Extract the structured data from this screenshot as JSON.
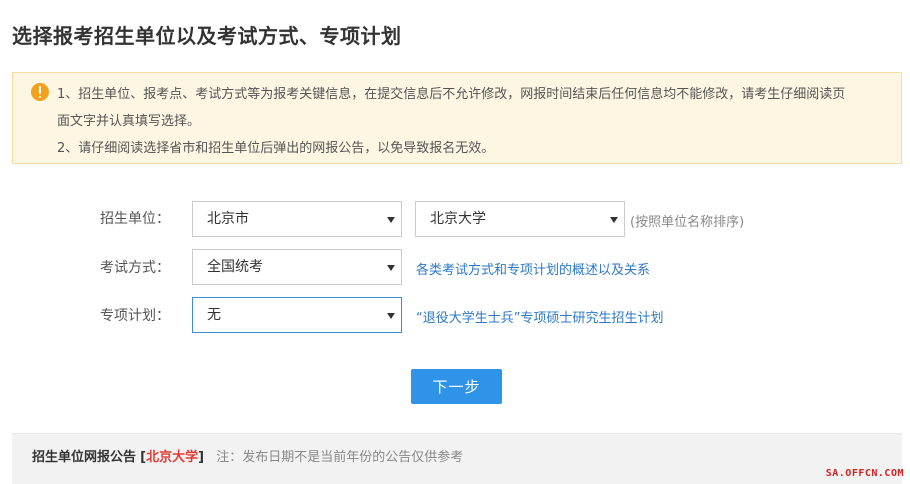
{
  "page": {
    "title": "选择报考招生单位以及考试方式、专项计划"
  },
  "notice": {
    "icon": "warning-icon",
    "line1": "1、招生单位、报考点、考试方式等为报考关键信息，在提交信息后不允许修改，网报时间结束后任何信息均不能修改，请考生仔细阅读页",
    "line2": "面文字并认真填写选择。",
    "line3": "2、请仔细阅读选择省市和招生单位后弹出的网报公告，以免导致报名无效。"
  },
  "form": {
    "unit": {
      "label": "招生单位：",
      "province_value": "北京市",
      "school_value": "北京大学",
      "hint": "(按照单位名称排序)"
    },
    "exam_method": {
      "label": "考试方式：",
      "value": "全国统考",
      "link": "各类考试方式和专项计划的概述以及关系"
    },
    "special_plan": {
      "label": "专项计划：",
      "value": "无",
      "link": "“退役大学生士兵”专项硕士研究生招生计划"
    },
    "next_button": "下一步"
  },
  "announcement": {
    "title": "招生单位网报公告",
    "bracket_open": "[",
    "unit": "北京大学",
    "bracket_close": "]",
    "note": "注：发布日期不是当前年份的公告仅供参考"
  },
  "watermark": "SA.OFFCN.COM",
  "colors": {
    "primary_button": "#2f93e8",
    "link": "#2b78c8",
    "notice_bg": "#fdf6e3",
    "notice_icon": "#f0a21d",
    "highlight_red": "#e53935"
  }
}
